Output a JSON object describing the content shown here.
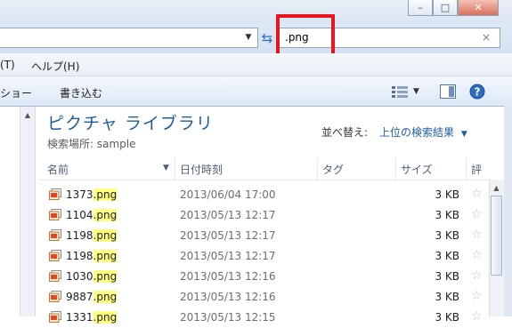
{
  "window_controls": [
    "–",
    "□",
    "✕"
  ],
  "address_bar": {
    "dropdown_icon": "chevron-down-icon",
    "refresh_icon": "refresh-icon"
  },
  "search": {
    "value": ".png",
    "clear_symbol": "×"
  },
  "menu": {
    "items": [
      "(T)",
      "ヘルプ(H)"
    ]
  },
  "commands": {
    "slideshow": "ショー",
    "burn": "書き込む"
  },
  "library": {
    "title": "ピクチャ ライブラリ",
    "location": "検索場所: sample",
    "sort_label": "並べ替え:",
    "sort_value": "上位の検索結果",
    "sort_arrow": "▼"
  },
  "columns": [
    "名前",
    "日付時刻",
    "タグ",
    "サイズ",
    "評"
  ],
  "files": [
    {
      "name": "1373",
      "ext": ".png",
      "date": "2013/06/04 17:00",
      "size": "3 KB"
    },
    {
      "name": "1104",
      "ext": ".png",
      "date": "2013/05/13 12:17",
      "size": "3 KB"
    },
    {
      "name": "1198",
      "ext": ".png",
      "date": "2013/05/13 12:17",
      "size": "3 KB"
    },
    {
      "name": "1198",
      "ext": ".png",
      "date": "2013/05/13 12:17",
      "size": "3 KB"
    },
    {
      "name": "1030",
      "ext": ".png",
      "date": "2013/05/13 12:16",
      "size": "3 KB"
    },
    {
      "name": "9887",
      "ext": ".png",
      "date": "2013/05/13 12:16",
      "size": "3 KB"
    },
    {
      "name": "1331",
      "ext": ".png",
      "date": "2013/05/13 12:15",
      "size": "3 KB"
    }
  ],
  "colors": {
    "accent": "#1c5e9c",
    "highlight_box": "#e8151f",
    "match_highlight": "#ffff80"
  }
}
